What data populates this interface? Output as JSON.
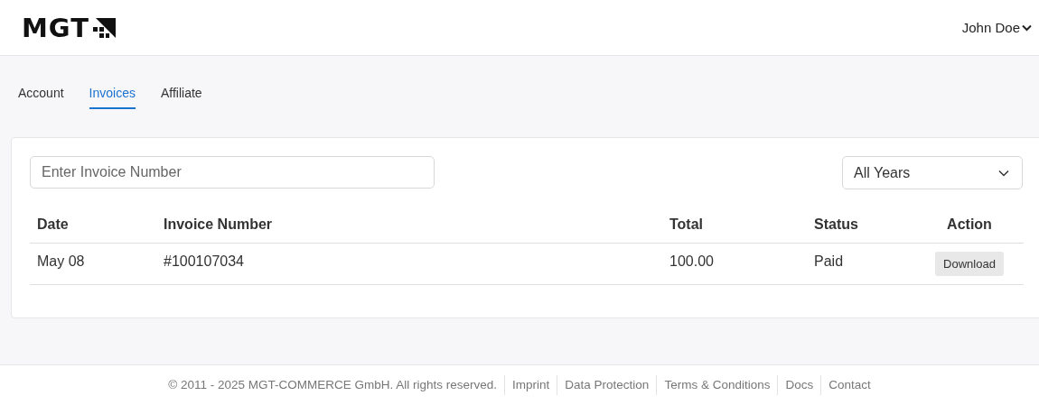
{
  "header": {
    "logo": "MGT",
    "user_menu": "John Doe"
  },
  "tabs": [
    {
      "label": "Account",
      "selected": false
    },
    {
      "label": "Invoices",
      "selected": true
    },
    {
      "label": "Affiliate",
      "selected": false
    }
  ],
  "search": {
    "placeholder": "Enter Invoice Number"
  },
  "year_filter": {
    "value": "All Years"
  },
  "table": {
    "columns": [
      "Date",
      "Invoice Number",
      "Total",
      "Status",
      "Action"
    ],
    "rows": [
      {
        "date": "May 08",
        "invoice_number": "#100107034",
        "total": "100.00",
        "status": "Paid",
        "action": "Download"
      }
    ]
  },
  "footer": {
    "copyright": "© 2011 - 2025 MGT-COMMERCE GmbH. All rights reserved.",
    "links": [
      "Imprint",
      "Data Protection",
      "Terms & Conditions",
      "Docs",
      "Contact"
    ]
  }
}
